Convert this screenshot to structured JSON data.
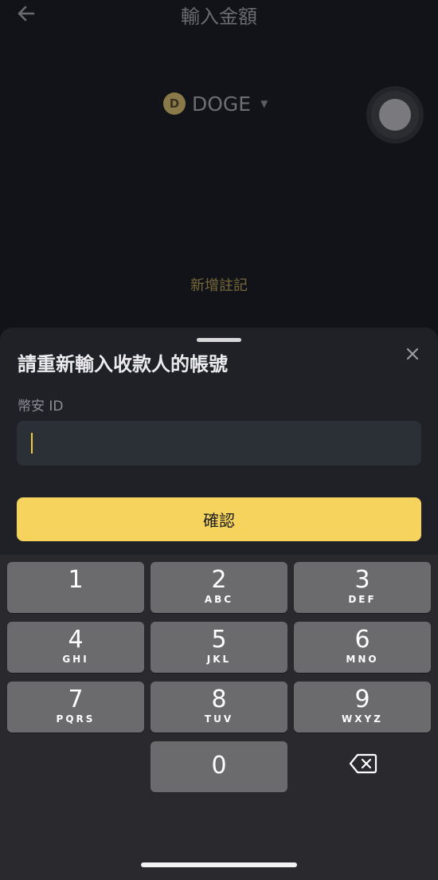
{
  "header": {
    "back_icon": "arrow-left-icon",
    "title": "輸入金額"
  },
  "coin": {
    "name": "DOGE",
    "logo_letter": "D",
    "dropdown_icon": "caret-down-icon"
  },
  "add_note": "新增註記",
  "sheet": {
    "title": "請重新輸入收款人的帳號",
    "close_icon": "close-icon",
    "field_label": "幣安 ID",
    "input_value": "",
    "confirm_label": "確認"
  },
  "keypad": {
    "keys": [
      {
        "num": "1",
        "letters": ""
      },
      {
        "num": "2",
        "letters": "ABC"
      },
      {
        "num": "3",
        "letters": "DEF"
      },
      {
        "num": "4",
        "letters": "GHI"
      },
      {
        "num": "5",
        "letters": "JKL"
      },
      {
        "num": "6",
        "letters": "MNO"
      },
      {
        "num": "7",
        "letters": "PQRS"
      },
      {
        "num": "8",
        "letters": "TUV"
      },
      {
        "num": "9",
        "letters": "WXYZ"
      },
      {
        "num": "0",
        "letters": ""
      }
    ],
    "delete_icon": "backspace-icon"
  },
  "colors": {
    "accent": "#f6d35c",
    "sheet_bg": "#1f2127",
    "key_bg": "#6b6b6e"
  }
}
